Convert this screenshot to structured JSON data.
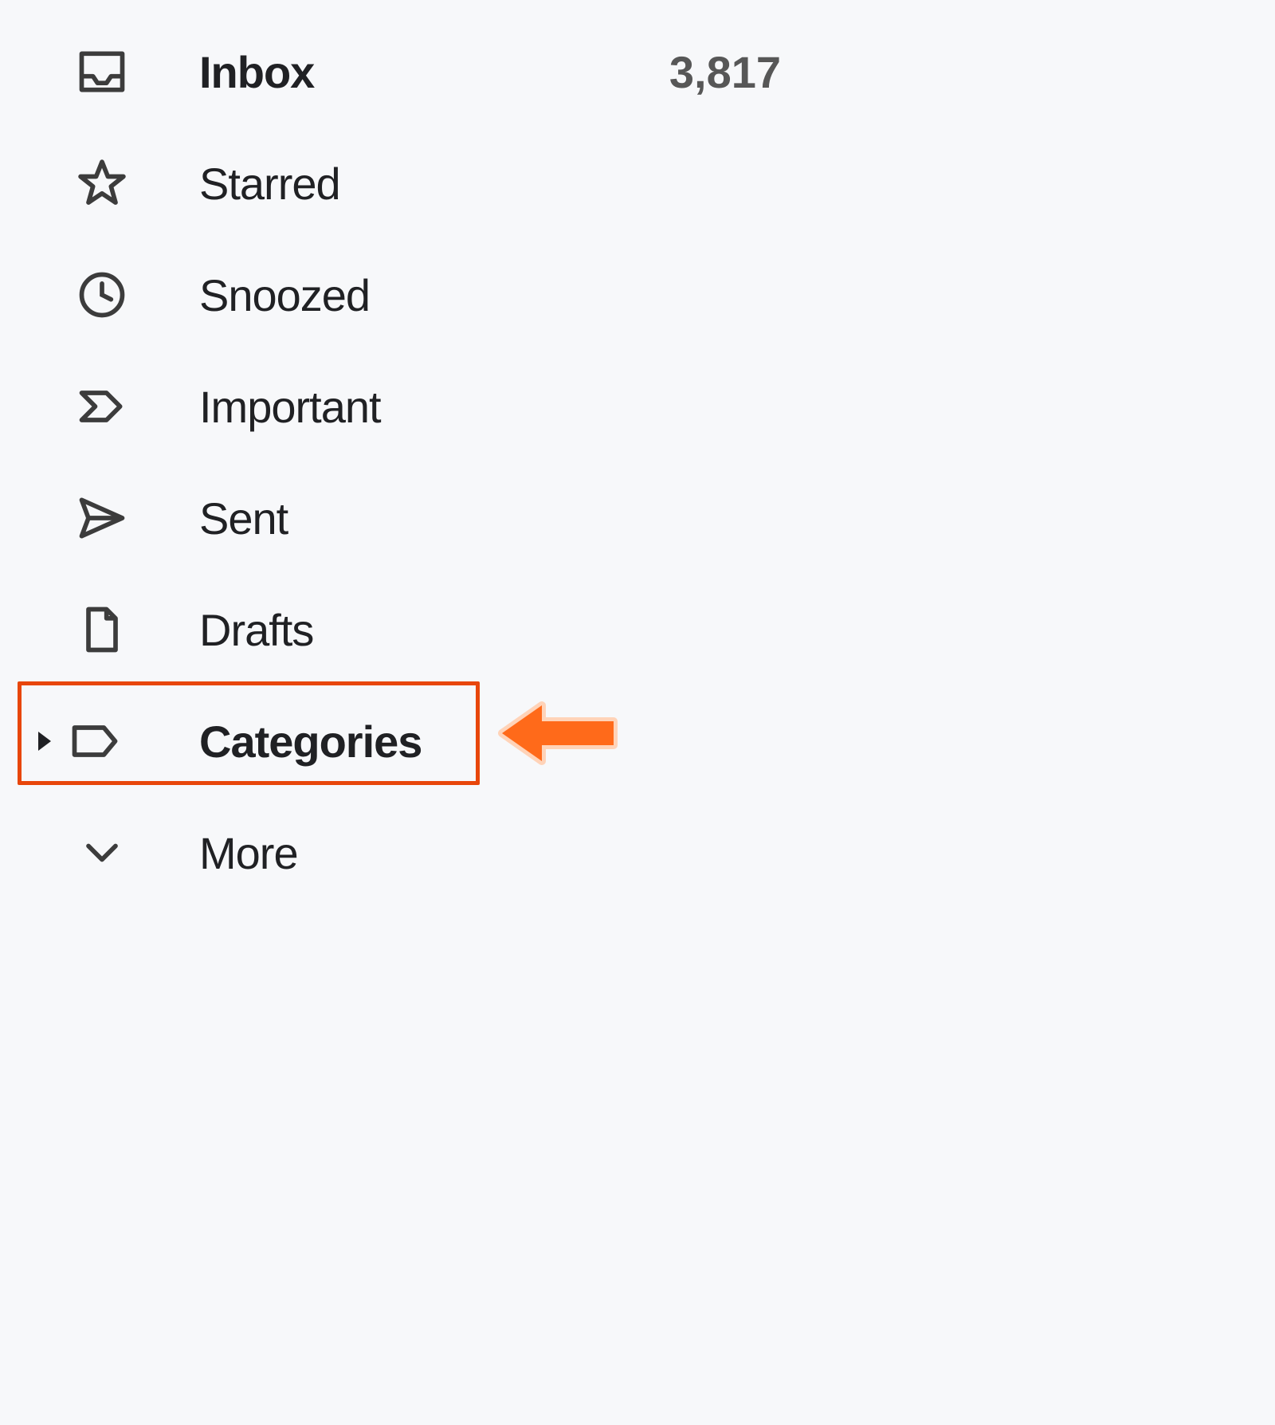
{
  "sidebar": {
    "items": [
      {
        "label": "Inbox",
        "count": "3,817",
        "bold": true,
        "iconName": "inbox-icon"
      },
      {
        "label": "Starred",
        "count": "",
        "bold": false,
        "iconName": "star-icon"
      },
      {
        "label": "Snoozed",
        "count": "",
        "bold": false,
        "iconName": "clock-icon"
      },
      {
        "label": "Important",
        "count": "",
        "bold": false,
        "iconName": "important-icon"
      },
      {
        "label": "Sent",
        "count": "",
        "bold": false,
        "iconName": "send-icon"
      },
      {
        "label": "Drafts",
        "count": "",
        "bold": false,
        "iconName": "draft-icon"
      },
      {
        "label": "Categories",
        "count": "",
        "bold": true,
        "iconName": "label-icon",
        "expandable": true
      },
      {
        "label": "More",
        "count": "",
        "bold": false,
        "iconName": "chevron-down-icon"
      }
    ]
  },
  "annotation": {
    "highlightColor": "#e8460b",
    "arrowColor": "#ff6a1a"
  }
}
